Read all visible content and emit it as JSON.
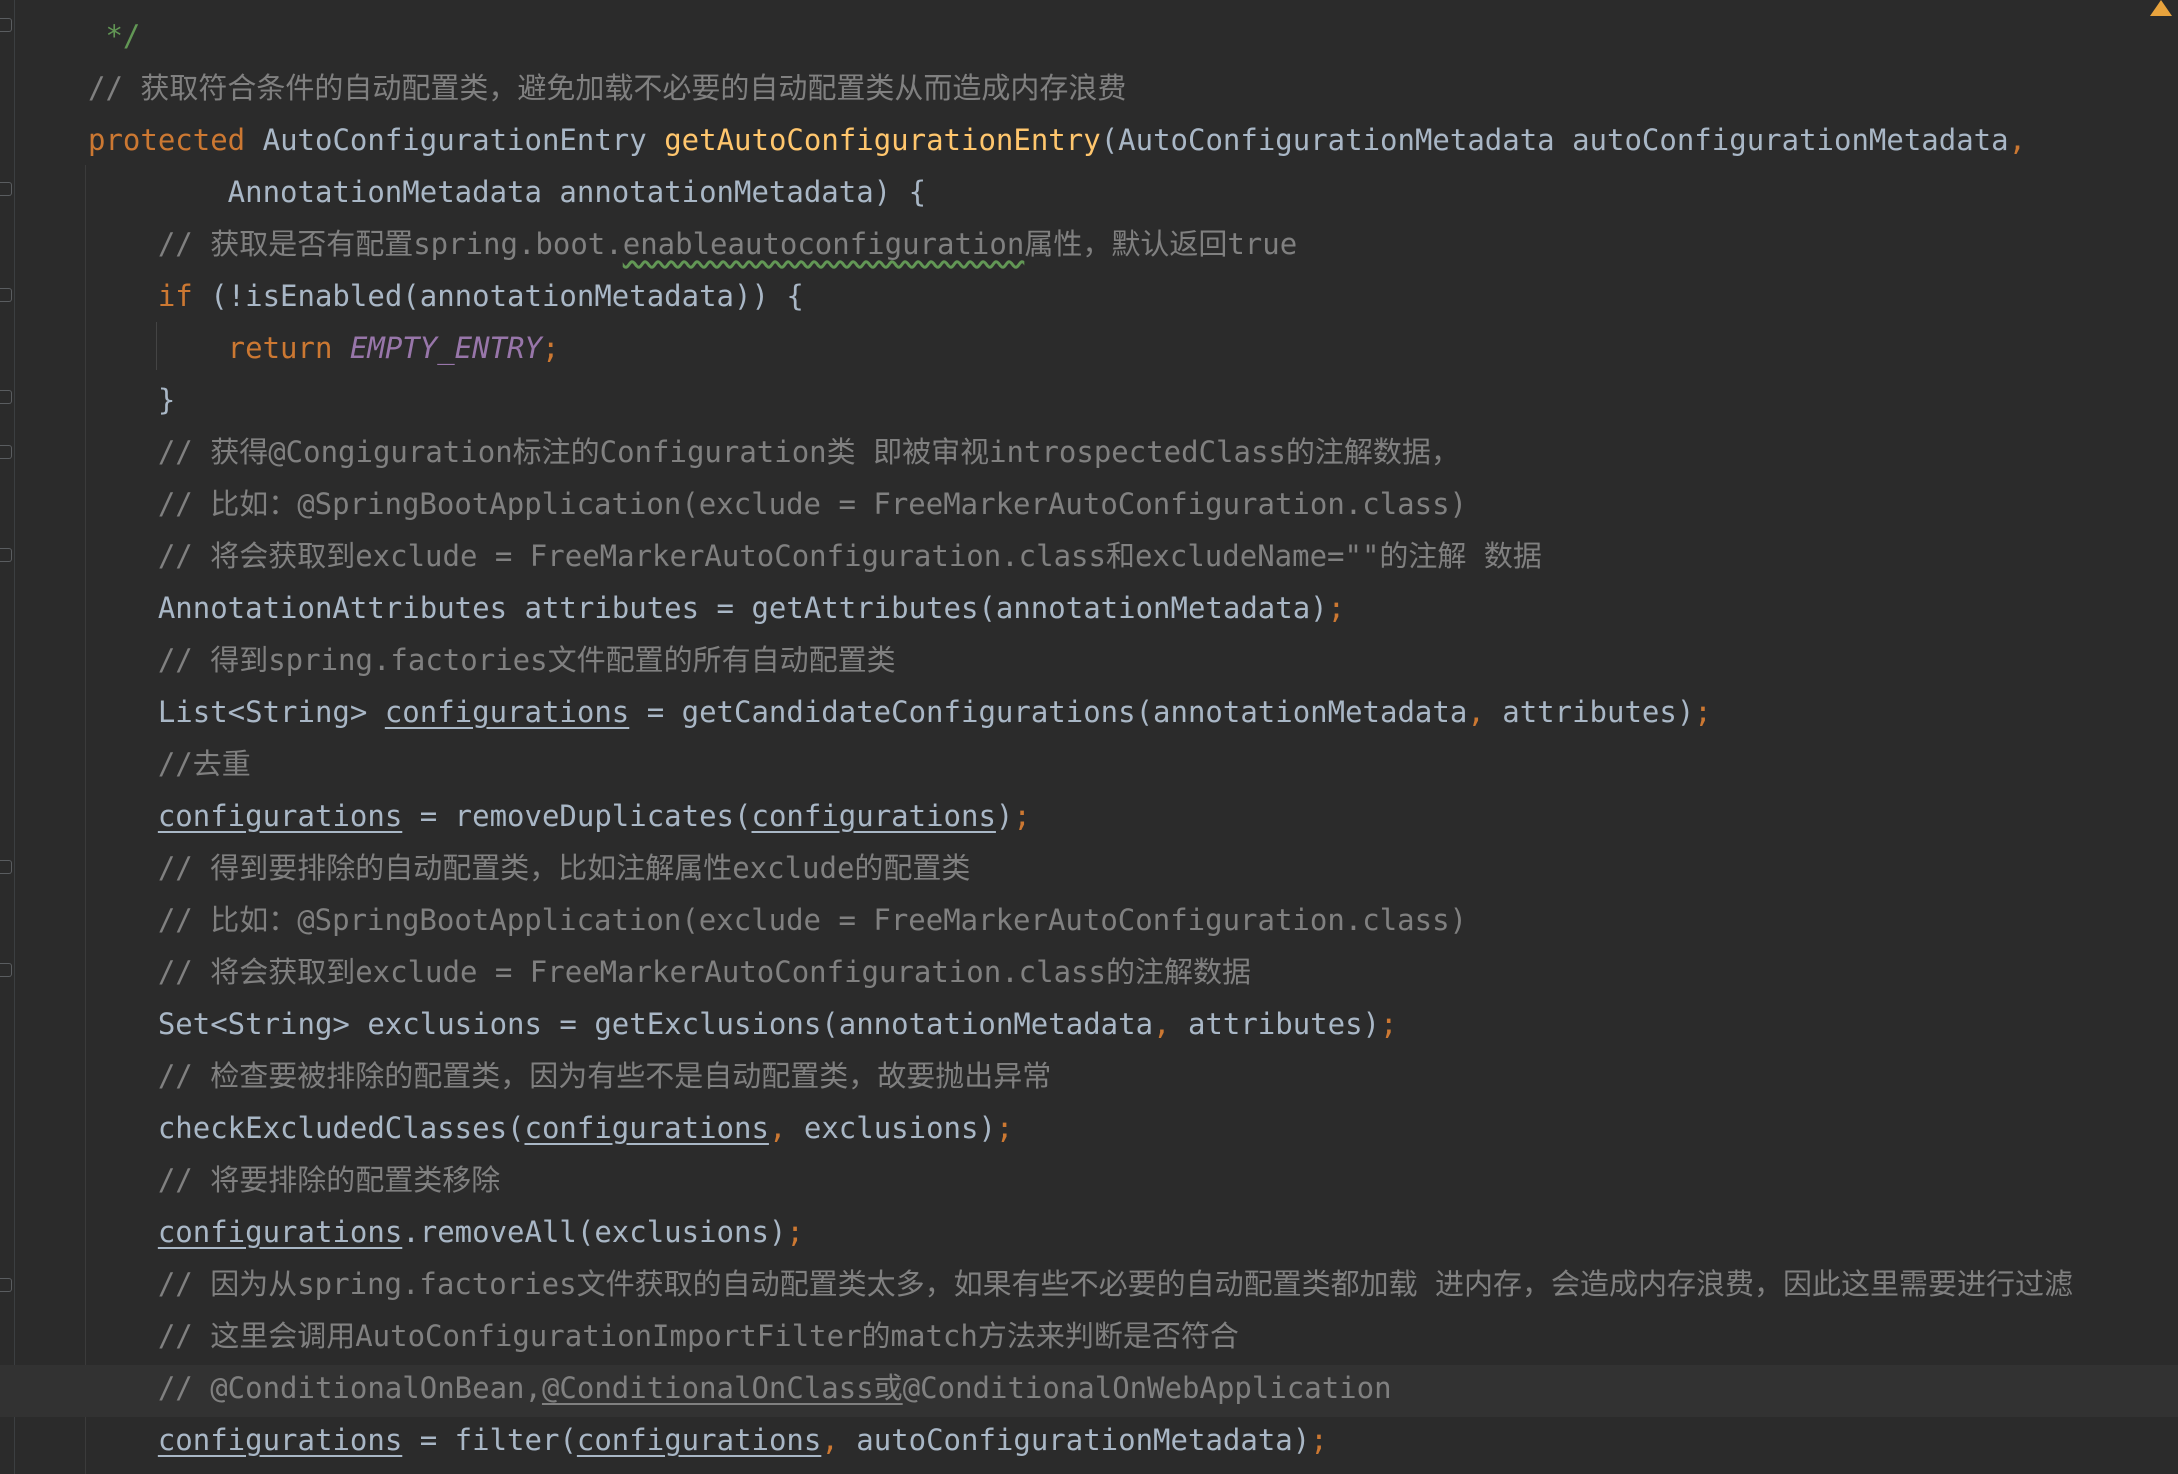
{
  "editor": {
    "lines": [
      {
        "parts": [
          {
            "t": " */",
            "c": "doc"
          }
        ]
      },
      {
        "parts": [
          {
            "t": "// 获取符合条件的自动配置类，避免加载不必要的自动配置类从而造成内存浪费",
            "c": "cm"
          }
        ]
      },
      {
        "parts": [
          {
            "t": "protected ",
            "c": "kw"
          },
          {
            "t": "AutoConfigurationEntry ",
            "c": ""
          },
          {
            "t": "getAutoConfigurationEntry",
            "c": "fn"
          },
          {
            "t": "(AutoConfigurationMetadata autoConfigurationMetadata",
            "c": ""
          },
          {
            "t": ",",
            "c": "pun"
          }
        ]
      },
      {
        "parts": [
          {
            "t": "        AnnotationMetadata annotationMetadata) {",
            "c": ""
          }
        ]
      },
      {
        "parts": [
          {
            "t": "    // 获取是否有配置spring.boot.",
            "c": "cm"
          },
          {
            "t": "enableautoconfiguration",
            "c": "cm wavy"
          },
          {
            "t": "属性，默认返回true",
            "c": "cm"
          }
        ]
      },
      {
        "parts": [
          {
            "t": "    if ",
            "c": "kw"
          },
          {
            "t": "(!isEnabled(annotationMetadata)) {",
            "c": ""
          }
        ]
      },
      {
        "parts": [
          {
            "t": "        return ",
            "c": "kw"
          },
          {
            "t": "EMPTY_ENTRY",
            "c": "const"
          },
          {
            "t": ";",
            "c": "pun"
          }
        ]
      },
      {
        "parts": [
          {
            "t": "    }",
            "c": ""
          }
        ]
      },
      {
        "parts": [
          {
            "t": "    // 获得@Congiguration标注的Configuration类 即被审视introspectedClass的注解数据，",
            "c": "cm"
          }
        ]
      },
      {
        "parts": [
          {
            "t": "    // 比如：@SpringBootApplication(exclude = FreeMarkerAutoConfiguration.class)",
            "c": "cm"
          }
        ]
      },
      {
        "parts": [
          {
            "t": "    // 将会获取到exclude = FreeMarkerAutoConfiguration.class和excludeName=\"\"的注解 数据",
            "c": "cm"
          }
        ]
      },
      {
        "parts": [
          {
            "t": "    AnnotationAttributes attributes = getAttributes(annotationMetadata)",
            "c": ""
          },
          {
            "t": ";",
            "c": "pun"
          }
        ]
      },
      {
        "parts": [
          {
            "t": "    // 得到spring.factories文件配置的所有自动配置类",
            "c": "cm"
          }
        ]
      },
      {
        "parts": [
          {
            "t": "    List<String> ",
            "c": ""
          },
          {
            "t": "configurations",
            "c": "u"
          },
          {
            "t": " = getCandidateConfigurations(annotationMetadata",
            "c": ""
          },
          {
            "t": ", ",
            "c": "pun"
          },
          {
            "t": "attributes)",
            "c": ""
          },
          {
            "t": ";",
            "c": "pun"
          }
        ]
      },
      {
        "parts": [
          {
            "t": "    //去重",
            "c": "cm"
          }
        ]
      },
      {
        "parts": [
          {
            "t": "    ",
            "c": ""
          },
          {
            "t": "configurations",
            "c": "u"
          },
          {
            "t": " = removeDuplicates(",
            "c": ""
          },
          {
            "t": "configurations",
            "c": "u"
          },
          {
            "t": ")",
            "c": ""
          },
          {
            "t": ";",
            "c": "pun"
          }
        ]
      },
      {
        "parts": [
          {
            "t": "    // 得到要排除的自动配置类，比如注解属性exclude的配置类",
            "c": "cm"
          }
        ]
      },
      {
        "parts": [
          {
            "t": "    // 比如：@SpringBootApplication(exclude = FreeMarkerAutoConfiguration.class)",
            "c": "cm"
          }
        ]
      },
      {
        "parts": [
          {
            "t": "    // 将会获取到exclude = FreeMarkerAutoConfiguration.class的注解数据",
            "c": "cm"
          }
        ]
      },
      {
        "parts": [
          {
            "t": "    Set<String> exclusions = getExclusions(annotationMetadata",
            "c": ""
          },
          {
            "t": ", ",
            "c": "pun"
          },
          {
            "t": "attributes)",
            "c": ""
          },
          {
            "t": ";",
            "c": "pun"
          }
        ]
      },
      {
        "parts": [
          {
            "t": "    // 检查要被排除的配置类，因为有些不是自动配置类，故要抛出异常",
            "c": "cm"
          }
        ]
      },
      {
        "parts": [
          {
            "t": "    checkExcludedClasses(",
            "c": ""
          },
          {
            "t": "configurations",
            "c": "u"
          },
          {
            "t": ", ",
            "c": "pun"
          },
          {
            "t": "exclusions)",
            "c": ""
          },
          {
            "t": ";",
            "c": "pun"
          }
        ]
      },
      {
        "parts": [
          {
            "t": "    // 将要排除的配置类移除",
            "c": "cm"
          }
        ]
      },
      {
        "parts": [
          {
            "t": "    ",
            "c": ""
          },
          {
            "t": "configurations",
            "c": "u"
          },
          {
            "t": ".removeAll(exclusions)",
            "c": ""
          },
          {
            "t": ";",
            "c": "pun"
          }
        ]
      },
      {
        "parts": [
          {
            "t": "    // 因为从spring.factories文件获取的自动配置类太多，如果有些不必要的自动配置类都加载 进内存，会造成内存浪费，因此这里需要进行过滤",
            "c": "cm"
          }
        ]
      },
      {
        "parts": [
          {
            "t": "    // 这里会调用AutoConfigurationImportFilter的match方法来判断是否符合",
            "c": "cm"
          }
        ]
      },
      {
        "parts": [
          {
            "t": "    // @ConditionalOnBean,",
            "c": "cm"
          },
          {
            "t": "@ConditionalOnClass或",
            "c": "cm u"
          },
          {
            "t": "@ConditionalOnWebApplication",
            "c": "cm"
          }
        ]
      },
      {
        "parts": [
          {
            "t": "    ",
            "c": ""
          },
          {
            "t": "configurations",
            "c": "u"
          },
          {
            "t": " = filter(",
            "c": ""
          },
          {
            "t": "configurations",
            "c": "u"
          },
          {
            "t": ", ",
            "c": "pun"
          },
          {
            "t": "autoConfigurationMetadata)",
            "c": ""
          },
          {
            "t": ";",
            "c": "pun"
          }
        ]
      }
    ]
  }
}
